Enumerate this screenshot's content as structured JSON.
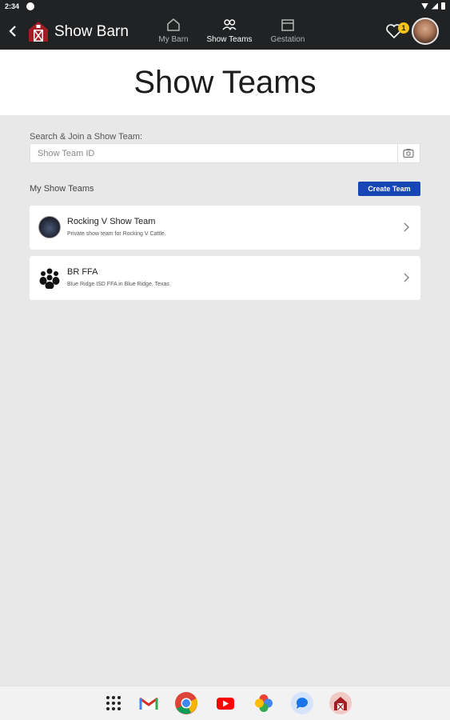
{
  "status_bar": {
    "time": "2:34"
  },
  "app_bar": {
    "title": "Show Barn",
    "nav": [
      {
        "label": "My Barn",
        "icon": "home-icon"
      },
      {
        "label": "Show Teams",
        "icon": "people-icon"
      },
      {
        "label": "Gestation",
        "icon": "calendar-icon"
      }
    ],
    "favorites_badge": "1"
  },
  "page": {
    "title": "Show Teams"
  },
  "search": {
    "label": "Search & Join a Show Team:",
    "placeholder": "Show Team ID"
  },
  "my_teams": {
    "label": "My Show Teams",
    "create_button": "Create Team",
    "teams": [
      {
        "name": "Rocking V Show Team",
        "description": "Private show team for Rocking V Cattle."
      },
      {
        "name": "BR FFA",
        "description": "Blue Ridge ISD FFA in Blue Ridge, Texas"
      }
    ]
  },
  "dock": {
    "apps": [
      "app-drawer-icon",
      "gmail-icon",
      "chrome-icon",
      "youtube-icon",
      "photos-icon",
      "messages-icon",
      "show-barn-app-icon"
    ]
  },
  "colors": {
    "app_bar": "#202224",
    "accent_blue": "#1746b5",
    "badge_yellow": "#f4c21a",
    "background": "#e8e8e8"
  }
}
